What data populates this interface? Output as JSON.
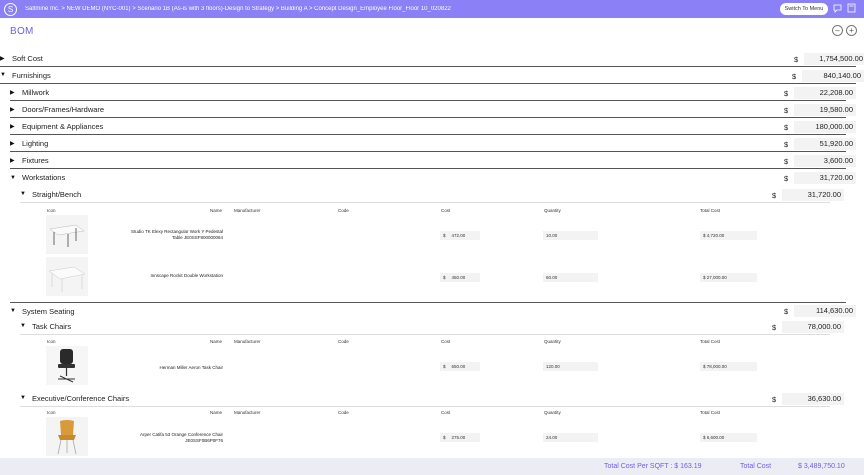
{
  "header": {
    "logo_letter": "S",
    "breadcrumb": "Saltmine Inc. > NEW DEMO (NYC-001) > Scenario 1B (As-is with 3 floors)-Design to Strategy > Building A > Concept Design_Employee Floor_Floor 10_020822",
    "switch_label": "Switch To Menu"
  },
  "page": {
    "title": "BOM",
    "collapse_symbol": "–",
    "add_symbol": "+"
  },
  "currency": "$",
  "categories": [
    {
      "label": "Soft Cost",
      "value": "1,754,500.00"
    },
    {
      "label": "Furnishings",
      "value": "840,140.00"
    }
  ],
  "furnishings": [
    {
      "label": "Millwork",
      "value": "22,208.00"
    },
    {
      "label": "Doors/Frames/Hardware",
      "value": "19,580.00"
    },
    {
      "label": "Equipment & Appliances",
      "value": "180,000.00"
    },
    {
      "label": "Lighting",
      "value": "51,920.00"
    },
    {
      "label": "Fixtures",
      "value": "3,600.00"
    },
    {
      "label": "Workstations",
      "value": "31,720.00"
    },
    {
      "label": "System Seating",
      "value": "114,630.00"
    }
  ],
  "subgroups": [
    {
      "label": "Straight/Bench",
      "value": "31,720.00"
    },
    {
      "label": "Task Chairs",
      "value": "78,000.00"
    },
    {
      "label": "Executive/Conference Chairs",
      "value": "36,630.00"
    }
  ],
  "columns": {
    "icon": "Icon",
    "name": "Name",
    "manufacturer": "Manufacturer",
    "code": "Code",
    "cost": "Cost",
    "quantity": "Quantity",
    "total": "Total Cost"
  },
  "items": [
    {
      "name_line1": "Studio TK Elexy Rectangular Work Y Pedestal",
      "name_line2": "Table JE0SSF800000064",
      "cost": "472.00",
      "qty": "10.00",
      "total": "$ 4,720.00"
    },
    {
      "name_line1": "Innscape Rockit Double Workstation",
      "name_line2": "",
      "cost": "450.00",
      "qty": "60.00",
      "total": "$ 27,000.00"
    },
    {
      "name_line1": "Herman Miller Aeron Task Chair",
      "name_line2": "",
      "cost": "650.00",
      "qty": "120.00",
      "total": "$ 78,000.00"
    },
    {
      "name_line1": "Arper Catifa 53 Orange Conference Chair",
      "name_line2": "JE0SSF0B6P0F76",
      "cost": "275.00",
      "qty": "24.00",
      "total": "$ 6,600.00"
    }
  ],
  "footer": {
    "per_sqft_label": "Total Cost Per SQFT : $ 163.19",
    "total_label": "Total Cost",
    "total_value": "$ 3,489,750.10"
  },
  "colors": {
    "accent": "#8b80f5",
    "title": "#6b61e8"
  }
}
